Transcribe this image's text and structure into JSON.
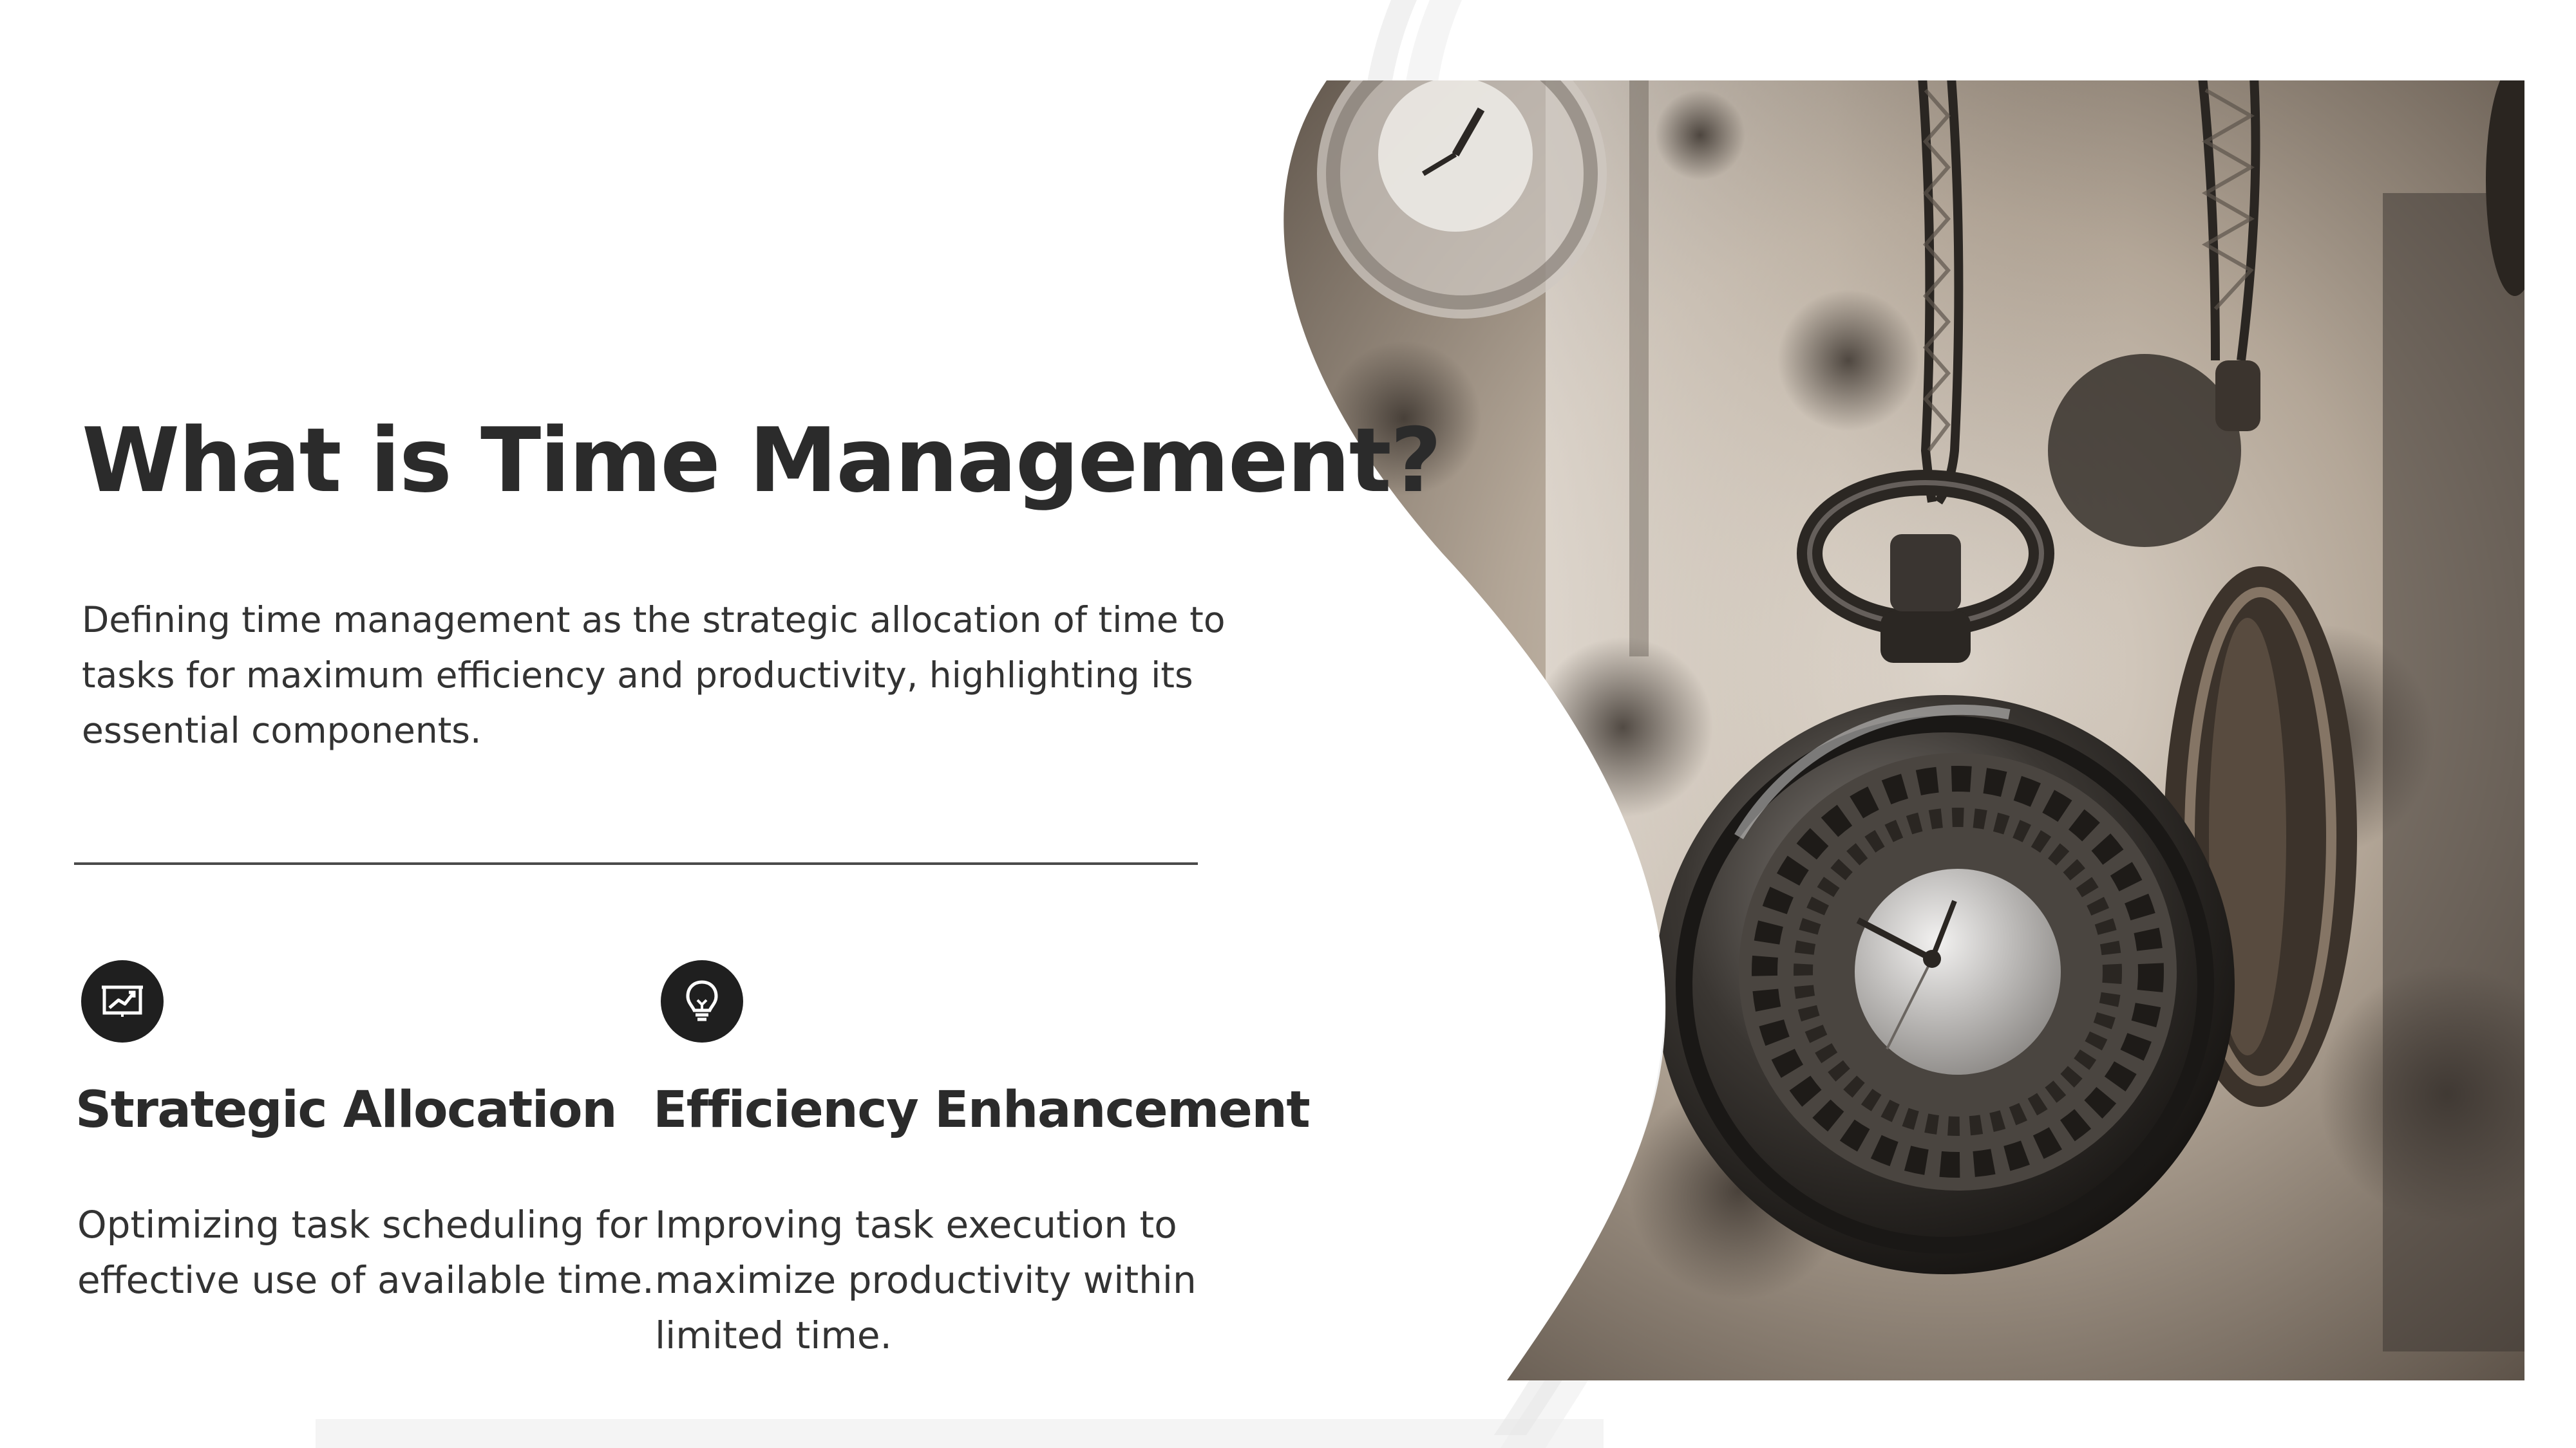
{
  "slide": {
    "title": "What is Time Management?",
    "subtitle": "Defining time management as the strategic allocation of time to tasks for maximum efficiency and productivity, highlighting its essential components."
  },
  "features": [
    {
      "icon": "chart-presentation-icon",
      "title": "Strategic Allocation",
      "description": "Optimizing task scheduling for effective use of available time."
    },
    {
      "icon": "lightbulb-icon",
      "title": "Efficiency Enhancement",
      "description": "Improving task execution to maximize productivity within limited time."
    }
  ],
  "image": {
    "subject": "pocket-watches-photo"
  },
  "colors": {
    "text": "#2b2b2b",
    "icon_background": "#1f1f1f",
    "background": "#ffffff",
    "divider": "#4a4a4a"
  }
}
